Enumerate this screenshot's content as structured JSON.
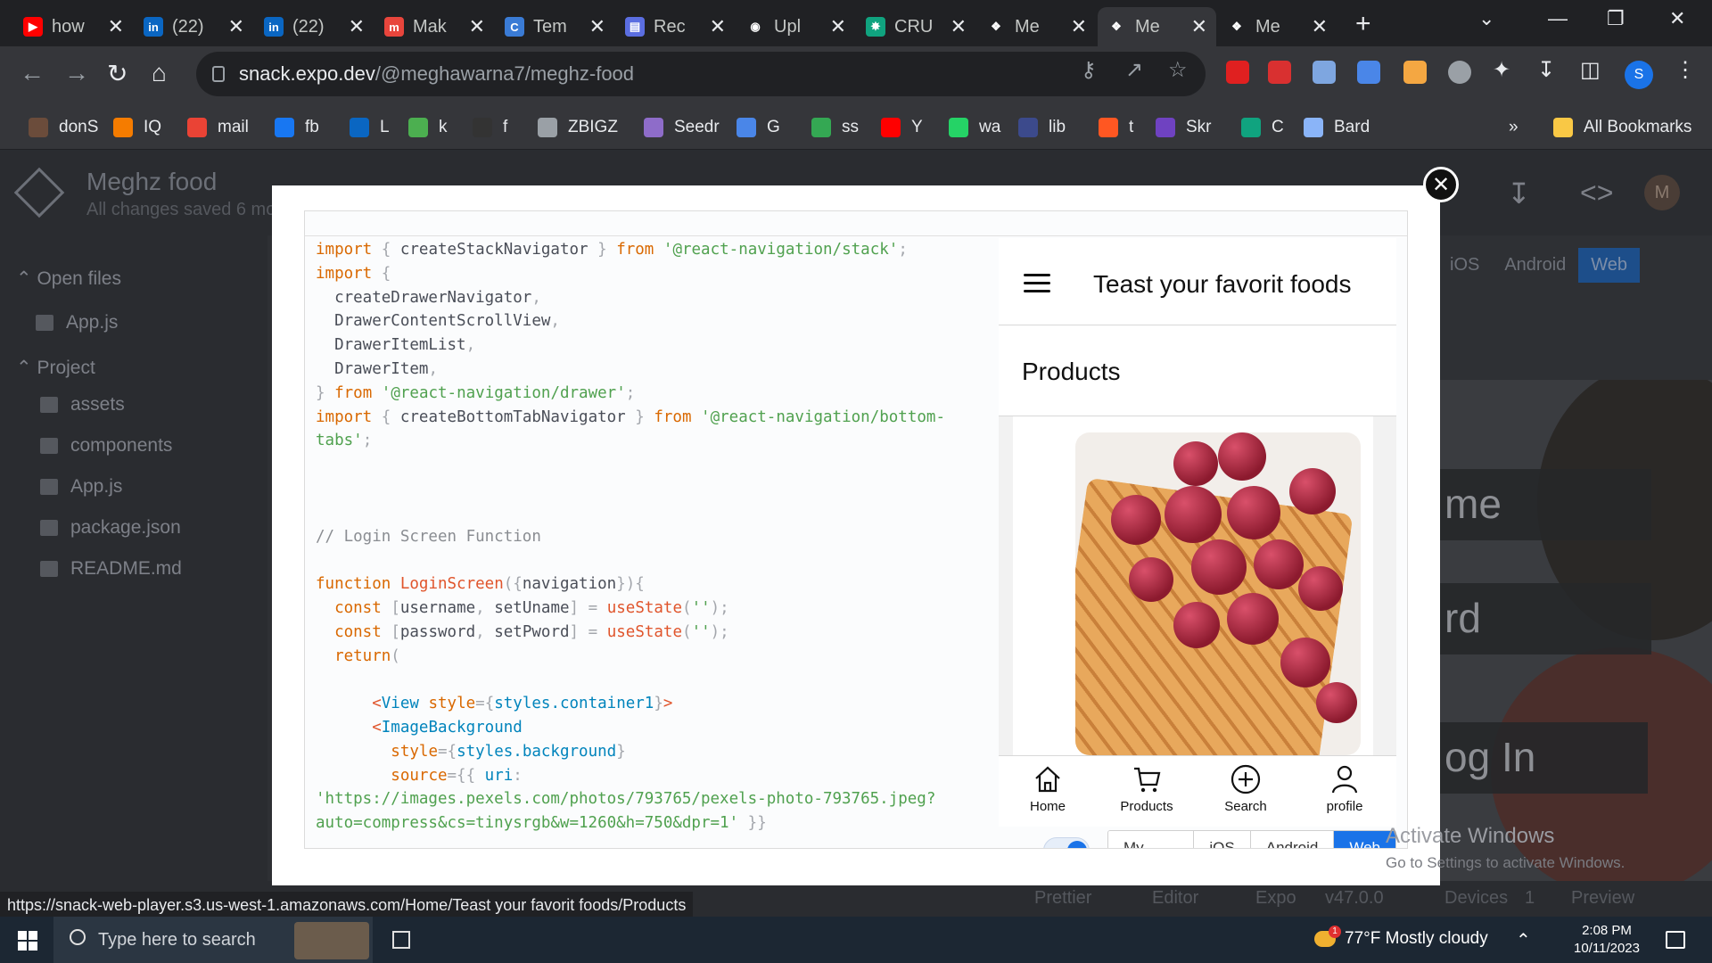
{
  "browser": {
    "tabs": [
      {
        "label": "how",
        "icon": "youtube-icon",
        "color": "#ff0000"
      },
      {
        "label": "(22)",
        "icon": "linkedin-icon",
        "color": "#0a66c2"
      },
      {
        "label": "(22)",
        "icon": "linkedin-icon",
        "color": "#0a66c2"
      },
      {
        "label": "Mak",
        "icon": "m-icon",
        "color": "#e8453c"
      },
      {
        "label": "Tem",
        "icon": "c-icon",
        "color": "#3a7bd5"
      },
      {
        "label": "Rec",
        "icon": "note-icon",
        "color": "#5b6ee1"
      },
      {
        "label": "Upl",
        "icon": "github-icon",
        "color": "#ffffff"
      },
      {
        "label": "CRU",
        "icon": "chatgpt-icon",
        "color": "#10a37f"
      },
      {
        "label": "Me",
        "icon": "expo-icon",
        "color": "#ffffff"
      },
      {
        "label": "Me",
        "icon": "expo-icon",
        "color": "#ffffff"
      },
      {
        "label": "Me",
        "icon": "expo-icon",
        "color": "#ffffff"
      }
    ],
    "url_host": "snack.expo.dev",
    "url_path": "/@meghawarna7/meghz-food",
    "profile_initial": "S",
    "bookmarks": [
      {
        "label": "donS"
      },
      {
        "label": "IQ"
      },
      {
        "label": "mail"
      },
      {
        "label": "fb"
      },
      {
        "label": "L"
      },
      {
        "label": "k"
      },
      {
        "label": "f"
      },
      {
        "label": "ZBIGZ"
      },
      {
        "label": "Seedr"
      },
      {
        "label": "G"
      },
      {
        "label": "ss"
      },
      {
        "label": "Y"
      },
      {
        "label": "wa"
      },
      {
        "label": "lib"
      },
      {
        "label": "t"
      },
      {
        "label": "Skr"
      },
      {
        "label": "C"
      },
      {
        "label": "Bard"
      }
    ],
    "more_bookmarks": "»",
    "all_bookmarks": "All Bookmarks",
    "status_url": "https://snack-web-player.s3.us-west-1.amazonaws.com/Home/Teast your favorit foods/Products"
  },
  "snack": {
    "project_title": "Meghz food",
    "save_status": "All changes saved 6 mo",
    "avatar_initial": "M",
    "open_files_label": "Open files",
    "open_files": [
      "App.js"
    ],
    "project_label": "Project",
    "project_files": [
      "assets",
      "components",
      "App.js",
      "package.json",
      "README.md"
    ],
    "platform_tabs": [
      "iOS",
      "Android",
      "Web"
    ],
    "bg_texts": [
      "me",
      "rd",
      "og In"
    ],
    "footer": {
      "prettier": "Prettier",
      "editor": "Editor",
      "expo": "Expo",
      "version": "v47.0.0",
      "devices": "Devices",
      "devices_count": "1",
      "preview": "Preview"
    }
  },
  "code_lines": [
    "import { createStackNavigator } from '@react-navigation/stack';",
    "import {",
    "  createDrawerNavigator,",
    "  DrawerContentScrollView,",
    "  DrawerItemList,",
    "  DrawerItem,",
    "} from '@react-navigation/drawer';",
    "import { createBottomTabNavigator } from '@react-navigation/bottom-",
    "tabs';",
    "",
    "",
    "",
    "// Login Screen Function",
    "",
    "function LoginScreen({navigation}){",
    "  const [username, setUname] = useState('');",
    "  const [password, setPword] = useState('');",
    "  return(",
    "",
    "      <View style={styles.container1}>",
    "      <ImageBackground",
    "        style={styles.background}",
    "        source={{ uri:",
    "'https://images.pexels.com/photos/793765/pexels-photo-793765.jpeg?",
    "auto=compress&cs=tinysrgb&w=1260&h=750&dpr=1' }}"
  ],
  "preview": {
    "app_title": "Teast your favorit foods",
    "screen_title": "Products",
    "tabs": [
      {
        "label": "Home",
        "icon": "home-icon"
      },
      {
        "label": "Products",
        "icon": "cart-icon"
      },
      {
        "label": "Search",
        "icon": "plus-circle-icon"
      },
      {
        "label": "profile",
        "icon": "person-icon"
      }
    ],
    "device_options": [
      "My Device",
      "iOS",
      "Android",
      "Web"
    ],
    "selected_device": "Web"
  },
  "windows": {
    "activate_title": "Activate Windows",
    "activate_sub": "Go to Settings to activate Windows.",
    "search_placeholder": "Type here to search",
    "weather": "77°F  Mostly cloudy",
    "weather_badge": "1",
    "time": "2:08 PM",
    "date": "10/11/2023"
  }
}
